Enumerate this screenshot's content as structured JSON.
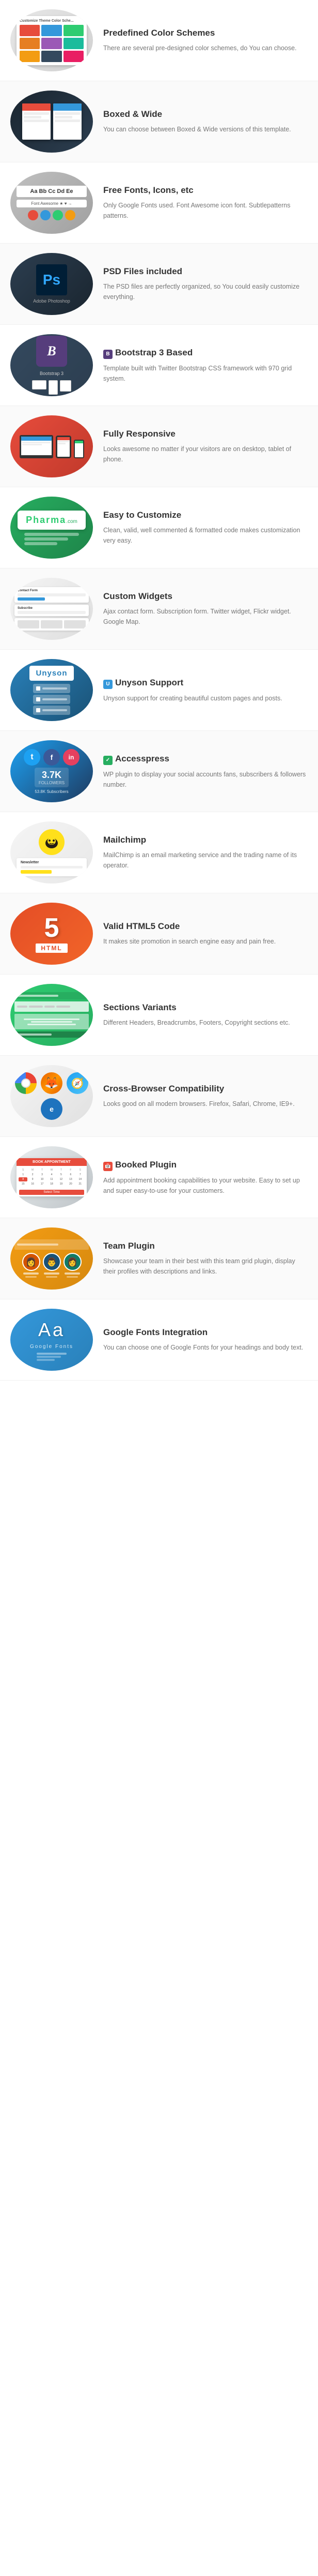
{
  "features": [
    {
      "id": "color-schemes",
      "title": "Predefined Color Schemes",
      "description": "There are several pre-designed color schemes, do You can choose.",
      "image_type": "color-schemes"
    },
    {
      "id": "boxed-wide",
      "title": "Boxed & Wide",
      "description": "You can choose between Boxed & Wide versions of this template.",
      "image_type": "boxed-wide"
    },
    {
      "id": "free-fonts",
      "title": "Free Fonts, Icons, etc",
      "description": "Only Google Fonts used. Font Awesome icon font. Subtlepatterns patterns.",
      "image_type": "free-fonts"
    },
    {
      "id": "psd-files",
      "title": "PSD Files included",
      "description": "The PSD files are perfectly organized, so You could easily customize everything.",
      "image_type": "psd"
    },
    {
      "id": "bootstrap",
      "title": "Bootstrap 3 Based",
      "description": "Template built with Twitter Bootstrap CSS framework with 970 grid system.",
      "image_type": "bootstrap",
      "title_icon": "B"
    },
    {
      "id": "responsive",
      "title": "Fully Responsive",
      "description": "Looks awesome no matter if your visitors are on desktop, tablet of phone.",
      "image_type": "responsive"
    },
    {
      "id": "customize",
      "title": "Easy to Customize",
      "description": "Clean, valid, well commented & formatted code makes customization very easy.",
      "image_type": "customize"
    },
    {
      "id": "widgets",
      "title": "Custom Widgets",
      "description": "Ajax contact form. Subscription form. Twitter widget, Flickr widget. Google Map.",
      "image_type": "widgets"
    },
    {
      "id": "unyson",
      "title": "Unyson Support",
      "description": "Unyson support for creating beautiful custom pages and posts.",
      "image_type": "unyson",
      "title_icon": "U"
    },
    {
      "id": "accesspress",
      "title": "Accesspress",
      "description": "WP plugin to display your social accounts fans, subscribers & followers number.",
      "image_type": "accesspress",
      "title_icon": "A"
    },
    {
      "id": "mailchimp",
      "title": "Mailchimp",
      "description": "MailChimp is an email marketing service and the trading name of its operator.",
      "image_type": "mailchimp"
    },
    {
      "id": "html5",
      "title": "Valid HTML5 Code",
      "description": "It makes site promotion in search engine easy and pain free.",
      "image_type": "html5"
    },
    {
      "id": "sections",
      "title": "Sections Variants",
      "description": "Different Headers, Breadcrumbs, Footers, Copyright sections etc.",
      "image_type": "sections"
    },
    {
      "id": "crossbrowser",
      "title": "Cross-Browser Compatibility",
      "description": "Looks good on all modern browsers. Firefox, Safari, Chrome, IE9+.",
      "image_type": "crossbrowser"
    },
    {
      "id": "booked",
      "title": "Booked Plugin",
      "description": "Add appointment booking capabilities to your website. Easy to set up and super easy-to-use for your customers.",
      "image_type": "booked",
      "title_icon": "cal"
    },
    {
      "id": "team",
      "title": "Team Plugin",
      "description": "Showcase your team in their best with this team grid plugin, display their profiles with descriptions and links.",
      "image_type": "team"
    },
    {
      "id": "googlefonts",
      "title": "Google Fonts Integration",
      "description": "You can choose one of Google Fonts for your headings and body text.",
      "image_type": "googlefonts"
    }
  ],
  "swatches": [
    "#e74c3c",
    "#3498db",
    "#2ecc71",
    "#e67e22",
    "#9b59b6",
    "#1abc9c",
    "#f39c12",
    "#34495e",
    "#e91e63"
  ],
  "social_number": "3.7K",
  "social_followers": "53.8K"
}
